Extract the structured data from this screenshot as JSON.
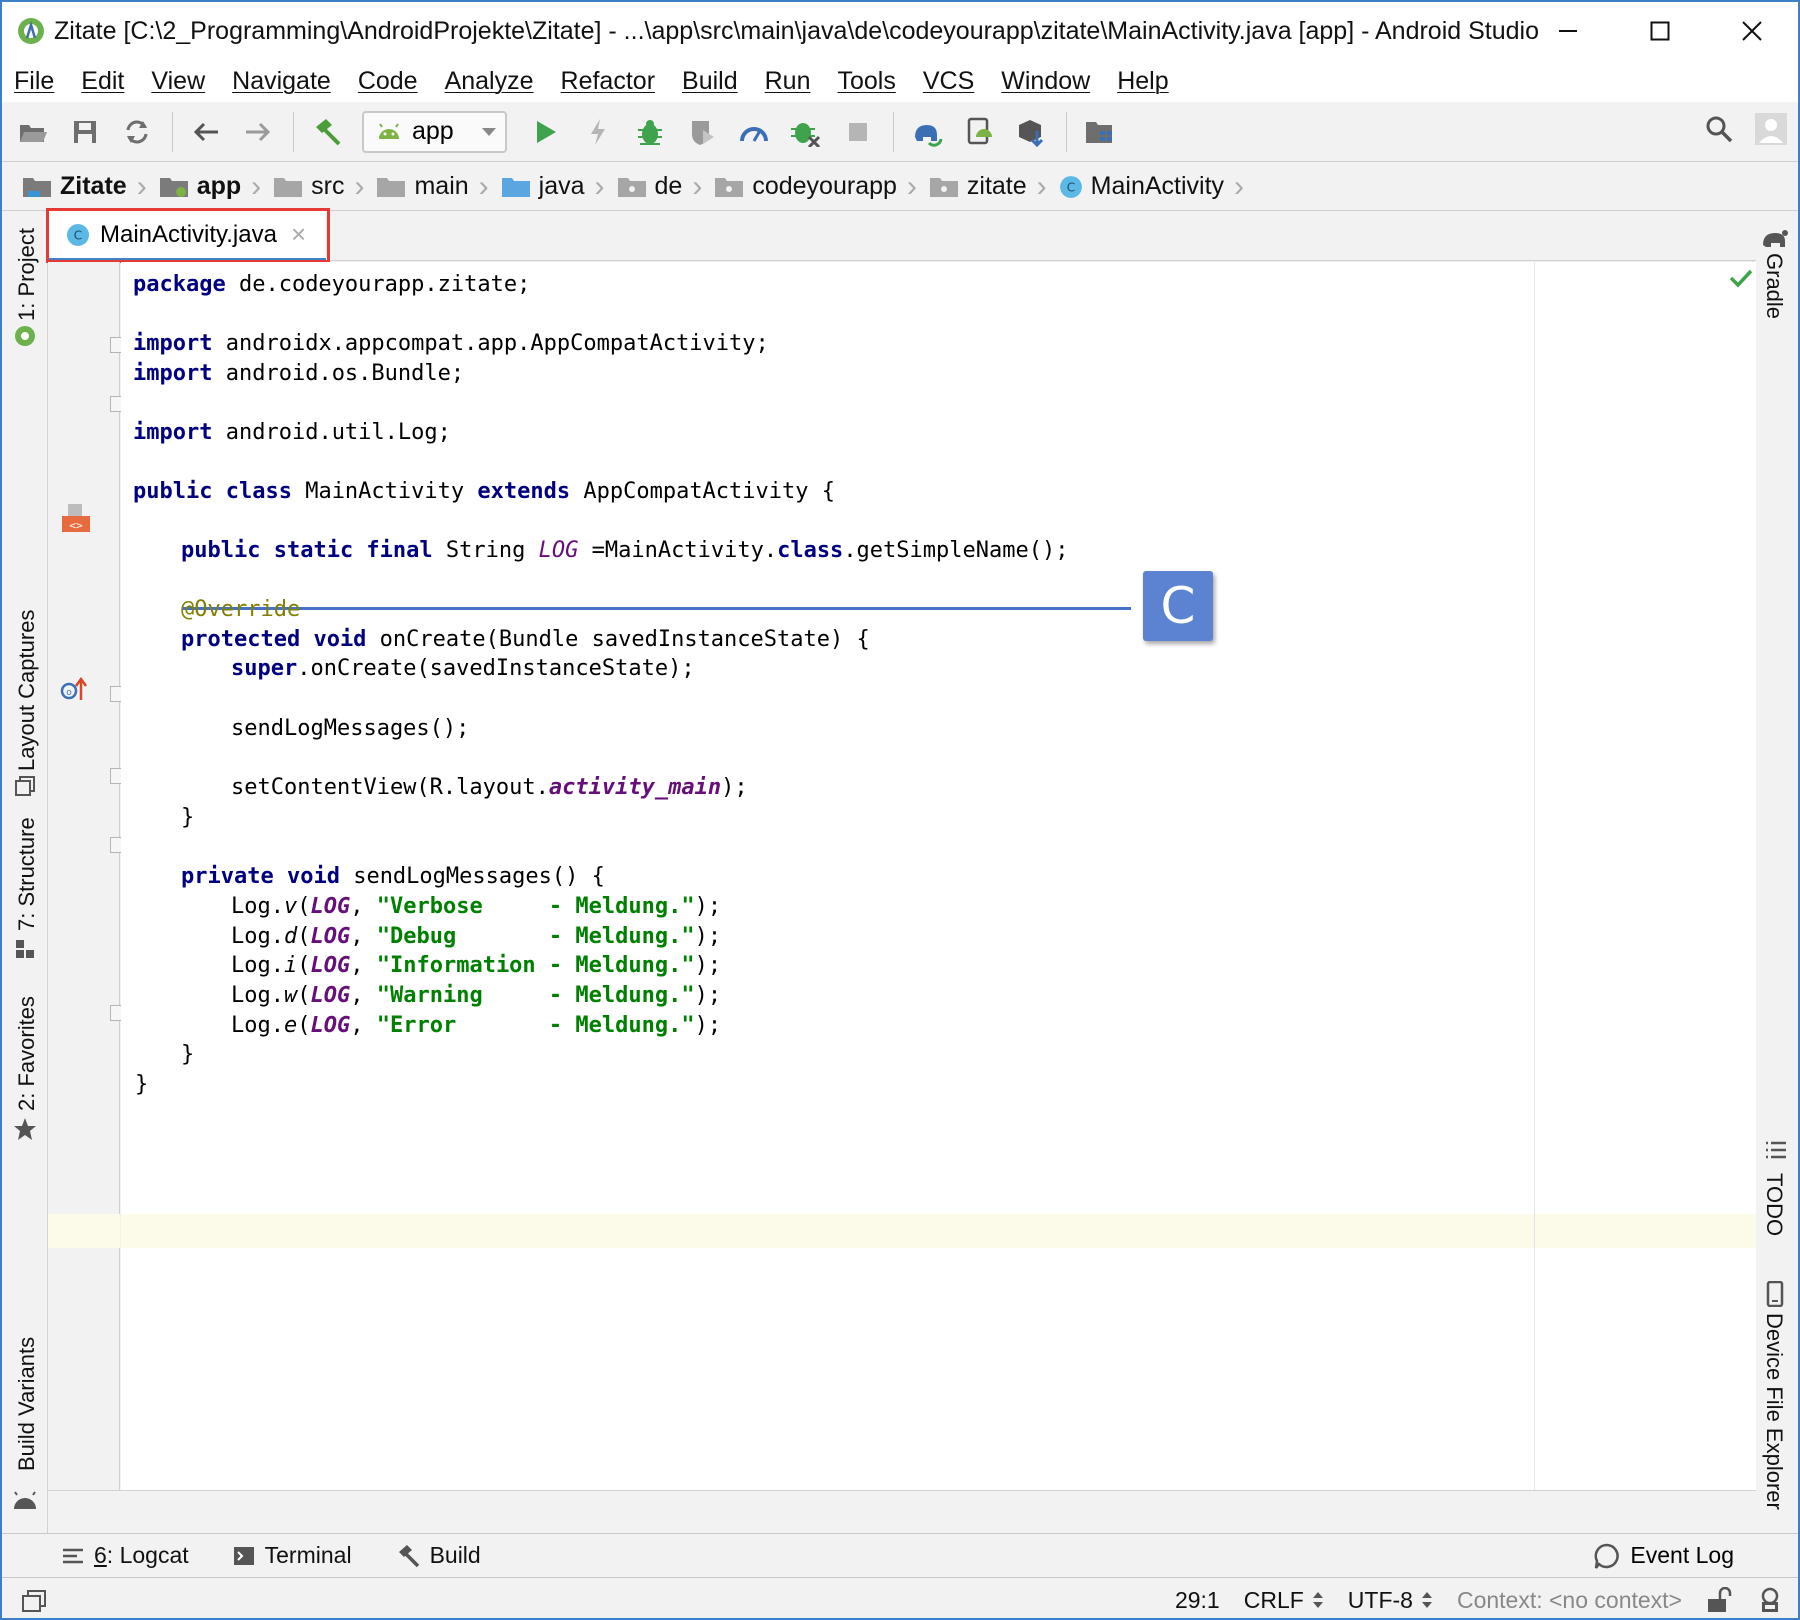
{
  "window": {
    "title": "Zitate [C:\\2_Programming\\AndroidProjekte\\Zitate] - ...\\app\\src\\main\\java\\de\\codeyourapp\\zitate\\MainActivity.java [app] - Android Studio",
    "accent": "#3b7fc4"
  },
  "menu": [
    "File",
    "Edit",
    "View",
    "Navigate",
    "Code",
    "Analyze",
    "Refactor",
    "Build",
    "Run",
    "Tools",
    "VCS",
    "Window",
    "Help"
  ],
  "toolbar": {
    "run_config": "app"
  },
  "breadcrumb": [
    "Zitate",
    "app",
    "src",
    "main",
    "java",
    "de",
    "codeyourapp",
    "zitate",
    "MainActivity"
  ],
  "editor_tab": {
    "label": "MainActivity.java",
    "close": "×",
    "highlight_color": "#e53935"
  },
  "side_tabs": {
    "left": [
      "1: Project",
      "Layout Captures",
      "7: Structure",
      "2: Favorites",
      "Build Variants"
    ],
    "right": [
      "Gradle",
      "TODO",
      "Device File Explorer"
    ]
  },
  "callout": {
    "label": "C",
    "color": "#5b83d2"
  },
  "code": {
    "line1": {
      "kw": "package",
      "rest": " de.codeyourapp.zitate;"
    },
    "line3": {
      "kw": "import",
      "rest": " androidx.appcompat.app.AppCompatActivity;"
    },
    "line4": {
      "kw": "import",
      "rest": " android.os.Bundle;"
    },
    "line6": {
      "kw": "import",
      "rest": " android.util.Log;"
    },
    "line8": {
      "kw1": "public class",
      "name": " MainActivity ",
      "kw2": "extends",
      "rest": " AppCompatActivity {"
    },
    "line10": {
      "kw": "public static final",
      "type": " String ",
      "fld": "LOG",
      "eq": " =MainActivity.",
      "kw2": "class",
      "rest": ".getSimpleName();"
    },
    "line12": {
      "ann": "@Override"
    },
    "line13": {
      "kw": "protected void",
      "rest": " onCreate(Bundle savedInstanceState) {"
    },
    "line14": {
      "kw": "super",
      "rest": ".onCreate(savedInstanceState);"
    },
    "line16": {
      "rest": "sendLogMessages();"
    },
    "line18": {
      "pre": "setContentView(R.layout.",
      "fld": "activity_main",
      "post": ");"
    },
    "line19": {
      "rest": "}"
    },
    "line21": {
      "kw": "private void",
      "rest": " sendLogMessages() {"
    },
    "log_lines": [
      {
        "pre": "Log.",
        "m": "v",
        "open": "(",
        "fld": "LOG",
        "comma": ", ",
        "str": "\"Verbose     - Meldung.\"",
        "post": ");"
      },
      {
        "pre": "Log.",
        "m": "d",
        "open": "(",
        "fld": "LOG",
        "comma": ", ",
        "str": "\"Debug       - Meldung.\"",
        "post": ");"
      },
      {
        "pre": "Log.",
        "m": "i",
        "open": "(",
        "fld": "LOG",
        "comma": ", ",
        "str": "\"Information - Meldung.\"",
        "post": ");"
      },
      {
        "pre": "Log.",
        "m": "w",
        "open": "(",
        "fld": "LOG",
        "comma": ", ",
        "str": "\"Warning     - Meldung.\"",
        "post": ");"
      },
      {
        "pre": "Log.",
        "m": "e",
        "open": "(",
        "fld": "LOG",
        "comma": ", ",
        "str": "\"Error       - Meldung.\"",
        "post": ");"
      }
    ],
    "line27": {
      "rest": "}"
    },
    "line28": {
      "rest": "}"
    }
  },
  "bottom_tabs": [
    {
      "num": "6",
      "label": ": Logcat"
    },
    {
      "label": "Terminal"
    },
    {
      "label": "Build"
    }
  ],
  "event_log": "Event Log",
  "status": {
    "position": "29:1",
    "line_sep": "CRLF",
    "encoding": "UTF-8",
    "context": "Context: <no context>"
  }
}
